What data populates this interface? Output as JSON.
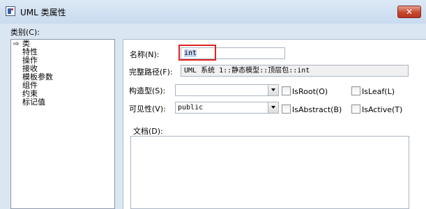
{
  "window": {
    "title": "UML 类属性",
    "close_label": "✕"
  },
  "category": {
    "label": "类别(C):",
    "items": [
      "类",
      "特性",
      "操作",
      "接收",
      "模板参数",
      "组件",
      "约束",
      "标记值"
    ]
  },
  "form": {
    "name_label": "名称(N):",
    "name_value": "int",
    "fullpath_label": "完整路径(F):",
    "fullpath_value": "UML 系统 1::静态模型::顶层包::int",
    "stereotype_label": "构造型(S):",
    "stereotype_value": "",
    "visibility_label": "可见性(V):",
    "visibility_value": "public",
    "isroot_label": "IsRoot(O)",
    "isleaf_label": "IsLeaf(L)",
    "isabstract_label": "IsAbstract(B)",
    "isactive_label": "IsActive(T)",
    "doc_label": "文档(D):"
  }
}
